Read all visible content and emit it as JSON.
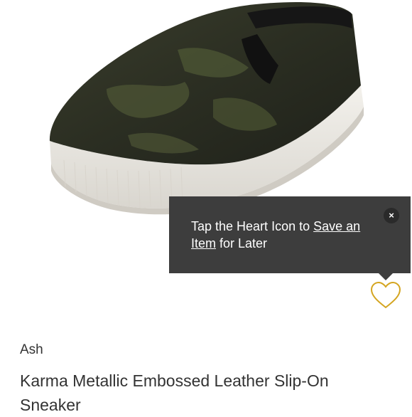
{
  "tooltip": {
    "text_before": "Tap the Heart Icon to ",
    "link_part1": "Save an",
    "link_part2": "Item",
    "text_after": " for Later",
    "close_symbol": "×"
  },
  "heart": {
    "icon": "heart-outline-icon",
    "color": "#d4a520"
  },
  "product": {
    "brand": "Ash",
    "title": "Karma Metallic Embossed Leather Slip-On Sneaker"
  }
}
